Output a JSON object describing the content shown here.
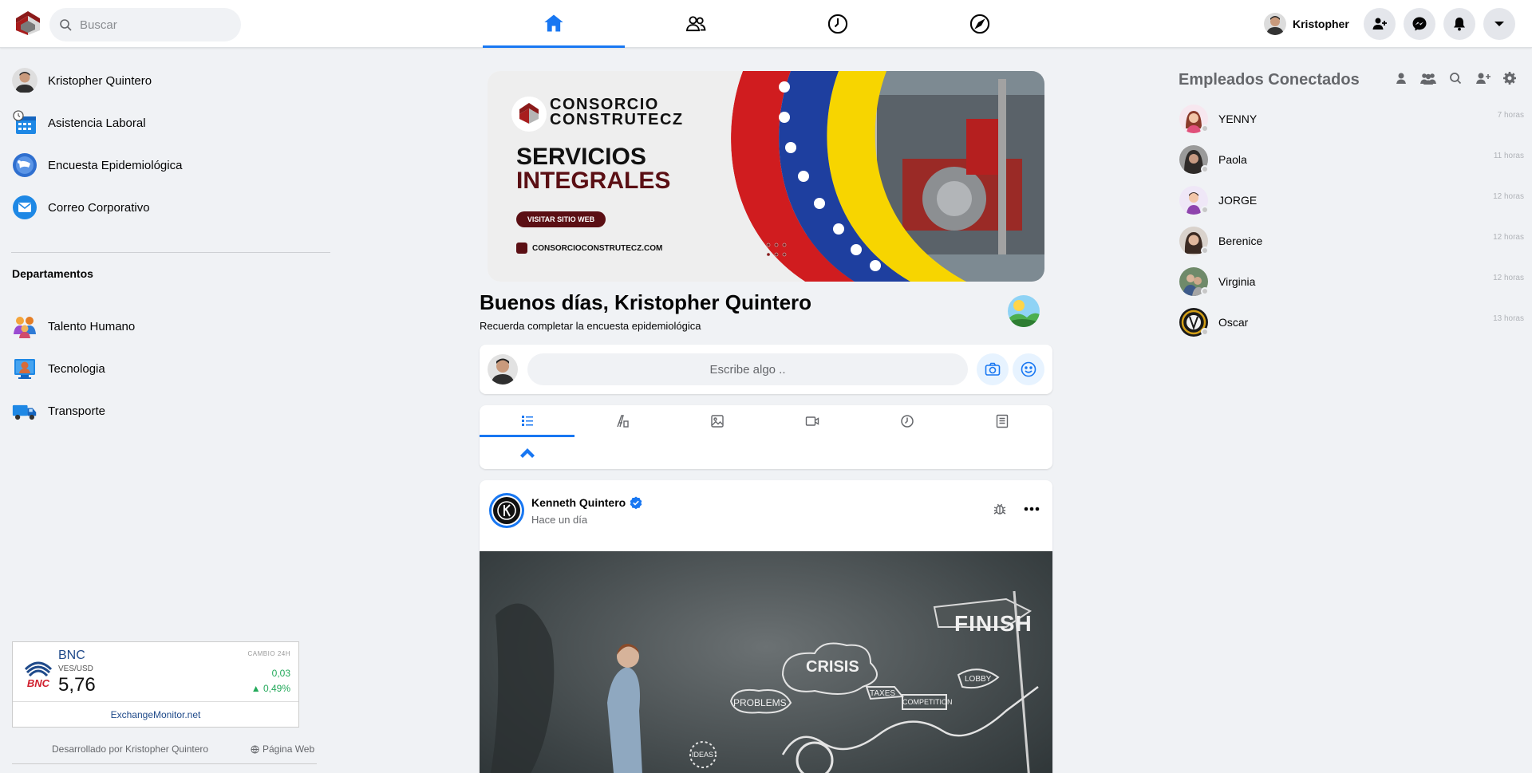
{
  "topbar": {
    "search_placeholder": "Buscar",
    "nav_tabs": [
      {
        "icon": "home-icon",
        "active": true
      },
      {
        "icon": "friends-icon",
        "active": false
      },
      {
        "icon": "clock-icon",
        "active": false
      },
      {
        "icon": "compass-icon",
        "active": false
      }
    ],
    "user_name": "Kristopher",
    "buttons": [
      "add-friend-icon",
      "messenger-icon",
      "bell-icon",
      "caret-down-icon"
    ],
    "accent": "#1877f2"
  },
  "sidebar": {
    "items": [
      {
        "label": "Kristopher Quintero",
        "icon": "avatar"
      },
      {
        "label": "Asistencia Laboral",
        "icon": "calendar-clock-icon"
      },
      {
        "label": "Encuesta Epidemiológica",
        "icon": "survey-icon"
      },
      {
        "label": "Correo Corporativo",
        "icon": "mail-icon"
      }
    ],
    "departments_title": "Departamentos",
    "departments": [
      {
        "label": "Talento Humano",
        "icon": "people-icon"
      },
      {
        "label": "Tecnologia",
        "icon": "tech-icon"
      },
      {
        "label": "Transporte",
        "icon": "truck-icon"
      }
    ],
    "exchange_widget": {
      "bank": "BNC",
      "pair": "VES/USD",
      "rate": "5,76",
      "change_label": "CAMBIO 24H",
      "change": "0,03",
      "change_pct": "▲ 0,49%",
      "link": "ExchangeMonitor.net"
    },
    "footer_dev": "Desarrollado por Kristopher Quintero",
    "footer_web": "Página Web"
  },
  "banner": {
    "brand_line1": "CONSORCIO",
    "brand_line2": "CONSTRUTECZ",
    "headline1": "SERVICIOS",
    "headline2": "INTEGRALES",
    "cta": "VISITAR SITIO WEB",
    "url": "CONSORCIOCONSTRUTECZ.COM"
  },
  "greeting": {
    "title": "Buenos días, Kristopher Quintero",
    "subtitle": "Recuerda completar la encuesta epidemiológica"
  },
  "composer": {
    "placeholder": "Escribe algo .."
  },
  "post_tabs": [
    "list-icon",
    "text-icon",
    "image-icon",
    "video-icon",
    "clock-icon",
    "document-icon"
  ],
  "post": {
    "author": "Kenneth Quintero",
    "time": "Hace un día",
    "image_words": [
      "FINISH",
      "CRISIS",
      "PROBLEMS",
      "TAXES",
      "COMPETITION",
      "LOBBY",
      "IDEAS"
    ]
  },
  "contacts": {
    "title": "Empleados Conectados",
    "list": [
      {
        "name": "YENNY",
        "time": "7 horas"
      },
      {
        "name": "Paola",
        "time": "11 horas"
      },
      {
        "name": "JORGE",
        "time": "12 horas"
      },
      {
        "name": "Berenice",
        "time": "12 horas"
      },
      {
        "name": "Virginia",
        "time": "12 horas"
      },
      {
        "name": "Oscar",
        "time": "13 horas"
      }
    ]
  }
}
